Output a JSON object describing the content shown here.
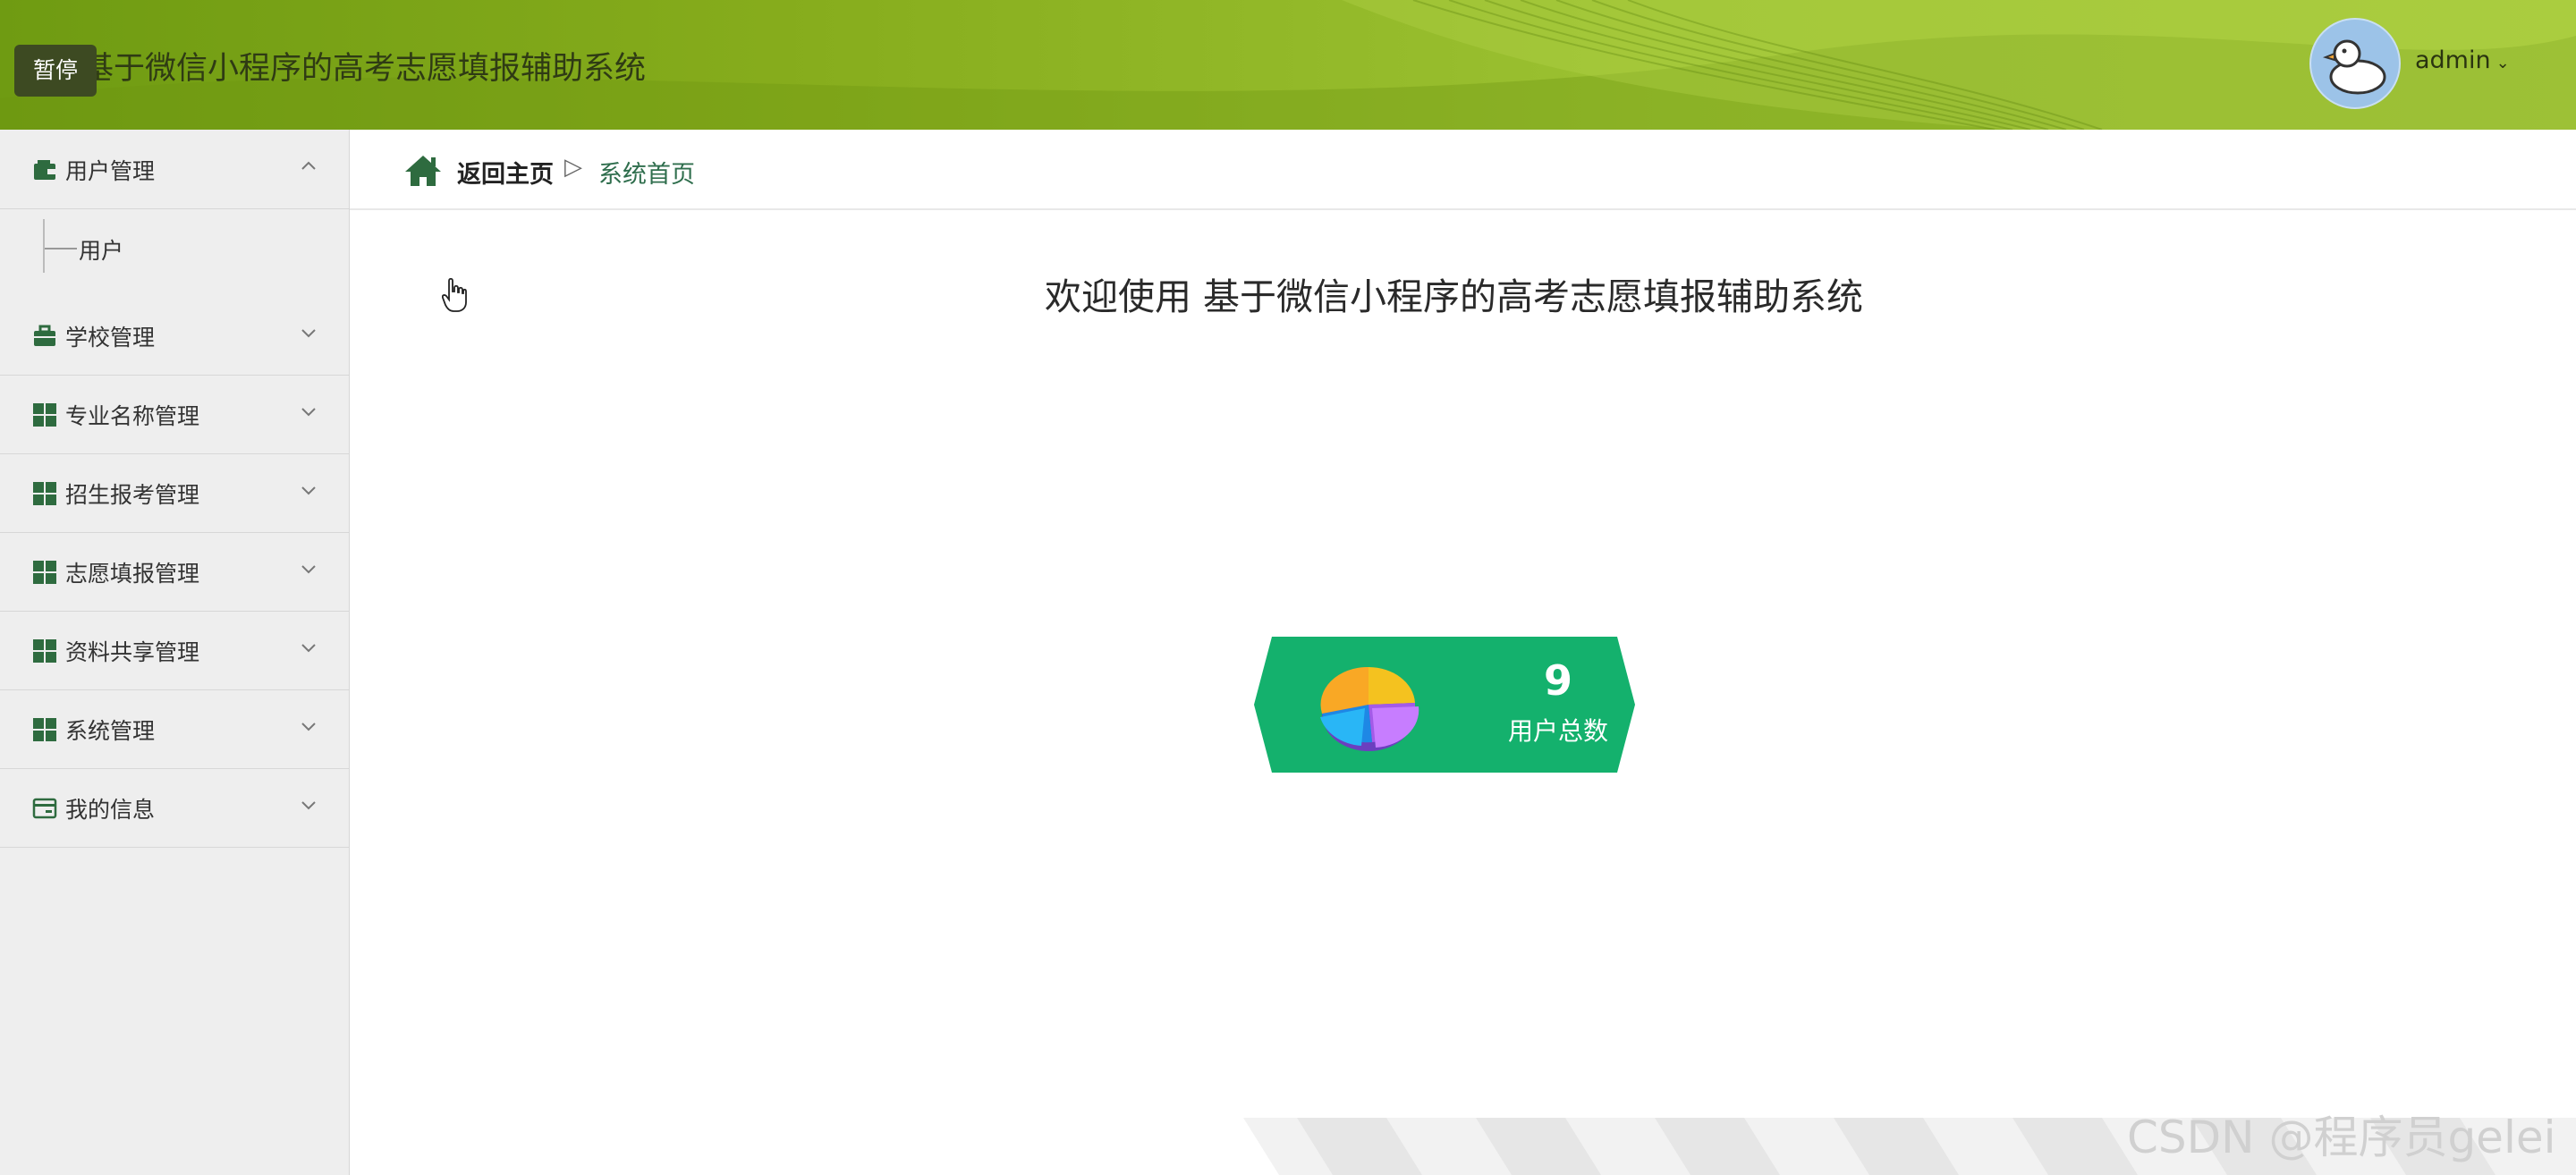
{
  "header": {
    "pause_label": "暂停",
    "app_title": "基于微信小程序的高考志愿填报辅助系统",
    "user_name": "admin",
    "colors": {
      "primary": "#8db424",
      "dark": "#3d4a22"
    }
  },
  "sidebar": {
    "items": [
      {
        "label": "用户管理",
        "icon": "wallet-icon",
        "expanded": true,
        "children": [
          {
            "label": "用户"
          }
        ]
      },
      {
        "label": "学校管理",
        "icon": "briefcase-icon"
      },
      {
        "label": "专业名称管理",
        "icon": "grid-icon"
      },
      {
        "label": "招生报考管理",
        "icon": "grid-icon"
      },
      {
        "label": "志愿填报管理",
        "icon": "grid-icon"
      },
      {
        "label": "资料共享管理",
        "icon": "grid-icon"
      },
      {
        "label": "系统管理",
        "icon": "grid-icon"
      },
      {
        "label": "我的信息",
        "icon": "card-icon"
      }
    ]
  },
  "breadcrumb": {
    "home": "返回主页",
    "separator": "▷",
    "current": "系统首页"
  },
  "main": {
    "welcome": "欢迎使用 基于微信小程序的高考志愿填报辅助系统",
    "stat": {
      "value": "9",
      "label": "用户总数",
      "color": "#14b16d"
    }
  },
  "watermark": "CSDN @程序员gelei"
}
